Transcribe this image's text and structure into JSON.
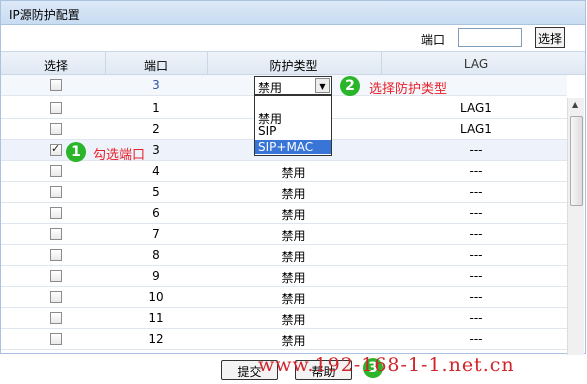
{
  "title": "IP源防护配置",
  "filter": {
    "port_label": "端口",
    "port_value": "",
    "search_button": "选择"
  },
  "columns": [
    "选择",
    "端口",
    "防护类型",
    "LAG"
  ],
  "edit_row": {
    "port": "3",
    "type": "禁用"
  },
  "dropdown_options": [
    "禁用",
    "SIP",
    "SIP+MAC"
  ],
  "rows": [
    {
      "port": "1",
      "type": "",
      "lag": "LAG1",
      "checked": false
    },
    {
      "port": "2",
      "type": "",
      "lag": "LAG1",
      "checked": false
    },
    {
      "port": "3",
      "type": "",
      "lag": "---",
      "checked": true
    },
    {
      "port": "4",
      "type": "禁用",
      "lag": "---",
      "checked": false
    },
    {
      "port": "5",
      "type": "禁用",
      "lag": "---",
      "checked": false
    },
    {
      "port": "6",
      "type": "禁用",
      "lag": "---",
      "checked": false
    },
    {
      "port": "7",
      "type": "禁用",
      "lag": "---",
      "checked": false
    },
    {
      "port": "8",
      "type": "禁用",
      "lag": "---",
      "checked": false
    },
    {
      "port": "9",
      "type": "禁用",
      "lag": "---",
      "checked": false
    },
    {
      "port": "10",
      "type": "禁用",
      "lag": "---",
      "checked": false
    },
    {
      "port": "11",
      "type": "禁用",
      "lag": "---",
      "checked": false
    },
    {
      "port": "12",
      "type": "禁用",
      "lag": "---",
      "checked": false
    }
  ],
  "annotations": {
    "step1_num": "1",
    "step1_text": "勾选端口",
    "step2_num": "2",
    "step2_text": "选择防护类型",
    "step3_num": "3"
  },
  "buttons": {
    "submit": "提交",
    "help": "帮助"
  },
  "watermark": "www.192-168-1-1.net.cn",
  "colors": {
    "annotation_green": "#2bb52b",
    "annotation_red": "#e8202a",
    "selected_option": "#3875d7"
  }
}
